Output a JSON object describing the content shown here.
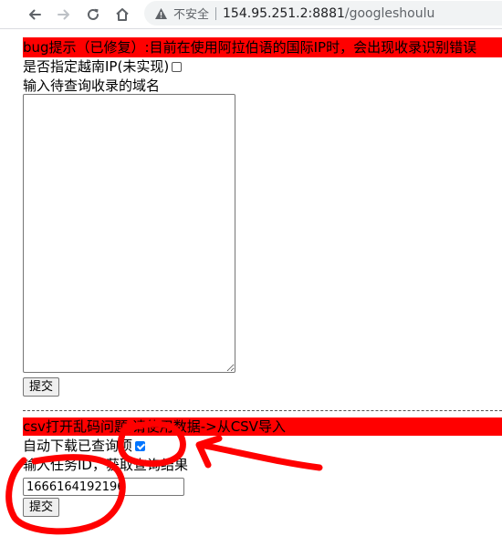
{
  "browser": {
    "security_label": "不安全",
    "url_host": "154.95.251.2:8881",
    "url_path": "/googleshoulu",
    "icons": {
      "back": "arrow-left-icon",
      "forward": "arrow-right-icon",
      "reload": "reload-icon",
      "home": "home-icon",
      "warning": "warning-triangle-icon"
    }
  },
  "page": {
    "bug_notice": "bug提示（已修复）:目前在使用阿拉伯语的国际IP时，会出现收录识别错误",
    "vietnam_ip_label": "是否指定越南IP(未实现)",
    "vietnam_ip_checked": false,
    "domains_label": "输入待查询收录的域名",
    "domains_value": "",
    "submit_label": "提交",
    "csv_notice": "csv打开乱码问题,请使用数据->从CSV导入",
    "auto_download_label": "自动下载已查询项",
    "auto_download_checked": true,
    "task_id_label": "输入任务ID，获取查询结果",
    "task_id_value": "1666164192196",
    "submit2_label": "提交"
  },
  "colors": {
    "banner_red": "#ff0000",
    "annotation_red": "#ff0000",
    "checkbox_blue": "#0075ff"
  }
}
